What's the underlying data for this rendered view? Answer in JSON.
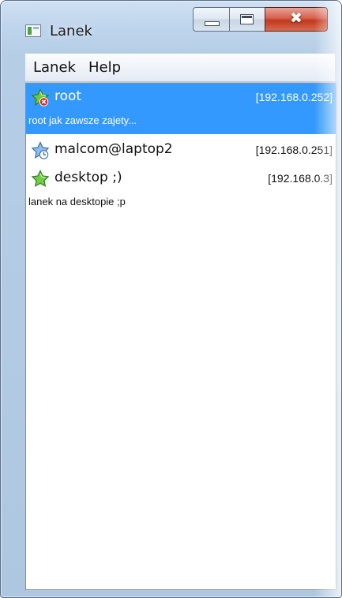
{
  "window": {
    "title": "Lanek",
    "icon": "app-window-icon",
    "controls": {
      "minimize": "minimize-icon",
      "maximize": "maximize-icon",
      "close": "✖"
    }
  },
  "menu": [
    {
      "label": "Lanek"
    },
    {
      "label": "Help"
    }
  ],
  "contacts": [
    {
      "name": "root",
      "ip": "[192.168.0.252]",
      "status": "root jak zawsze zajety...",
      "icon": "star-busy-icon",
      "selected": true
    },
    {
      "name": "malcom@laptop2",
      "ip": "[192.168.0.251]",
      "status": "",
      "icon": "star-away-icon",
      "selected": false
    },
    {
      "name": "desktop ;)",
      "ip": "[192.168.0.3]",
      "status": "lanek na desktopie ;p",
      "icon": "star-online-icon",
      "selected": false
    }
  ],
  "colors": {
    "selection": "#3399ff",
    "star_green": "#5fbf3a",
    "star_blue": "#6fa7e0",
    "busy_red": "#d8231f"
  }
}
